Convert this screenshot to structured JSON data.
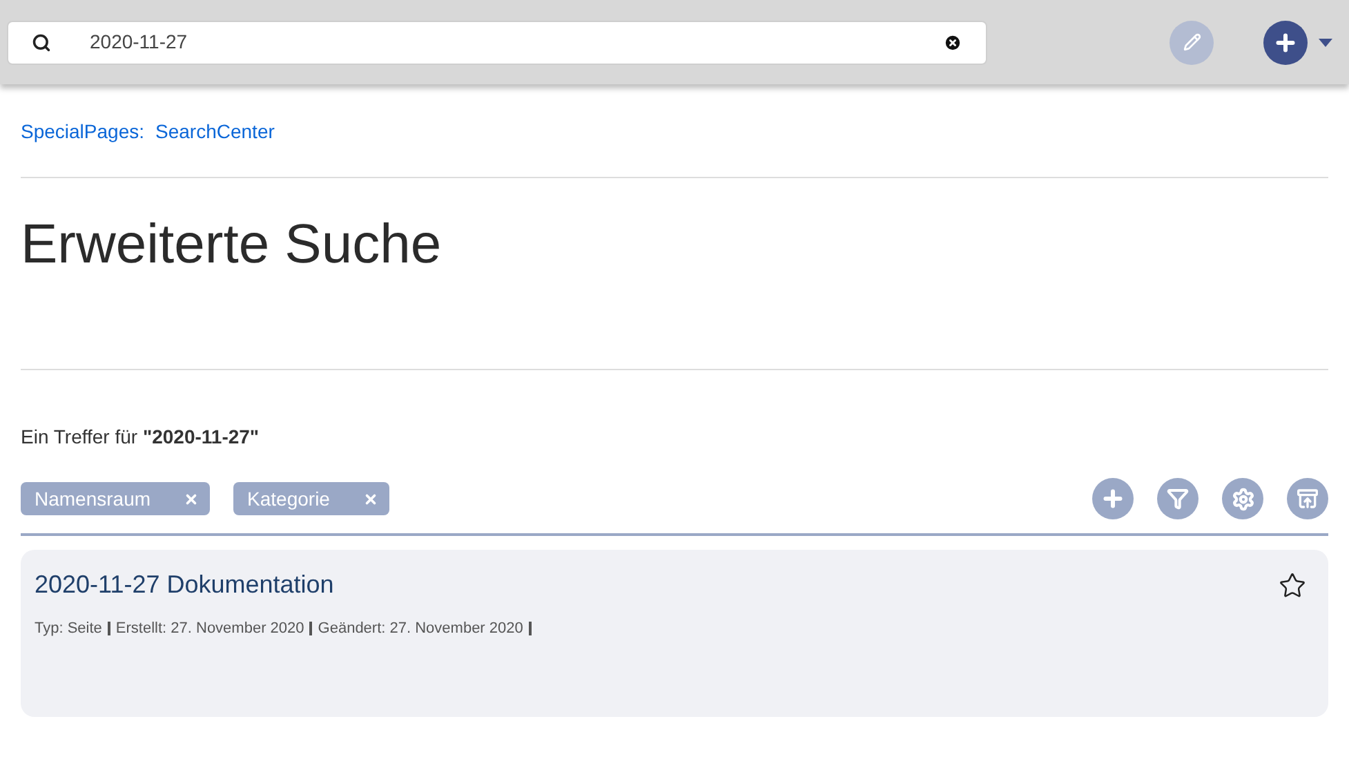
{
  "search": {
    "value": "2020-11-27"
  },
  "header_buttons": [
    {
      "kind": "edit",
      "disabled": true
    },
    {
      "kind": "create",
      "disabled": false
    }
  ],
  "breadcrumb": [
    "SpecialPages:",
    "SearchCenter"
  ],
  "title": "Erweiterte Suche",
  "result_count": "Ein Treffer für **\"2020-11-27\"**",
  "filters": [
    {
      "label": "Namensraum"
    },
    {
      "label": "Kategorie"
    }
  ],
  "tools": [
    {
      "kind": "add"
    },
    {
      "kind": "filter"
    },
    {
      "kind": "settings"
    },
    {
      "kind": "export"
    }
  ],
  "results": [
    {
      "title": "2020-11-27 Dokumentation",
      "starred": false,
      "meta": [
        "Typ: Seite",
        "Erstellt: 27. November 2020",
        "Geändert: 27. November 2020"
      ]
    }
  ]
}
